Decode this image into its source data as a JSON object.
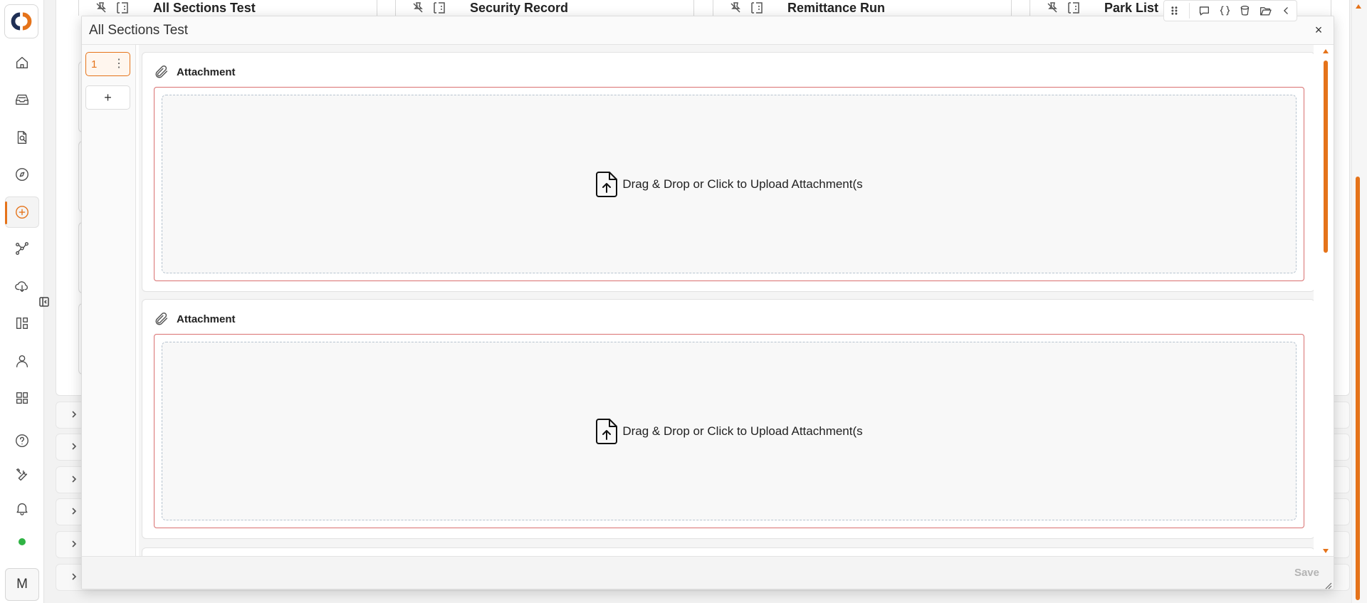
{
  "app": {
    "brand_colors": {
      "accent": "#e5731a",
      "status_online": "#2fb344"
    },
    "user_initial": "M"
  },
  "sidebar": {
    "items": [
      {
        "name": "home-icon"
      },
      {
        "name": "inbox-icon"
      },
      {
        "name": "document-search-icon"
      },
      {
        "name": "compass-icon"
      },
      {
        "name": "add-circle-icon",
        "active": true
      },
      {
        "name": "workflow-icon"
      },
      {
        "name": "cloud-download-icon"
      },
      {
        "name": "dashboard-icon"
      },
      {
        "name": "user-icon"
      },
      {
        "name": "layout-icon"
      },
      {
        "name": "help-icon"
      },
      {
        "name": "tools-icon"
      },
      {
        "name": "bell-icon"
      }
    ]
  },
  "background_tabs": [
    {
      "label": "All Sections Test"
    },
    {
      "label": "Security Record"
    },
    {
      "label": "Remittance Run"
    },
    {
      "label": "Park List"
    }
  ],
  "modal": {
    "title": "All Sections Test",
    "close_label": "×",
    "section_rail": {
      "sections": [
        {
          "number": "1"
        }
      ],
      "add_label": "+"
    },
    "fields": [
      {
        "label": "Attachment",
        "upload_text": "Drag & Drop or Click to Upload Attachment(s"
      },
      {
        "label": "Attachment",
        "upload_text": "Drag & Drop or Click to Upload Attachment(s"
      }
    ],
    "footer": {
      "save_label": "Save"
    }
  }
}
